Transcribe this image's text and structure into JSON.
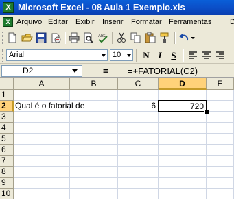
{
  "window": {
    "title": "Microsoft Excel - 08 Aula 1 Exemplo.xls"
  },
  "menu": {
    "items": [
      {
        "label": "Arquivo"
      },
      {
        "label": "Editar"
      },
      {
        "label": "Exibir"
      },
      {
        "label": "Inserir"
      },
      {
        "label": "Formatar"
      },
      {
        "label": "Ferramentas"
      },
      {
        "label": "D"
      }
    ]
  },
  "toolbar": {
    "icons": [
      "new-icon",
      "open-icon",
      "save-icon",
      "permission-icon",
      "print-icon",
      "print-preview-icon",
      "spelling-icon",
      "cut-icon",
      "copy-icon",
      "paste-icon",
      "format-painter-icon",
      "undo-icon"
    ]
  },
  "format_toolbar": {
    "font_name": "Arial",
    "font_size": "10",
    "bold_label": "N",
    "italic_label": "I",
    "underline_label": "S"
  },
  "formula_bar": {
    "name_box": "D2",
    "equals": "=",
    "formula": "=+FATORIAL(C2)"
  },
  "sheet": {
    "columns": [
      "A",
      "B",
      "C",
      "D",
      "E"
    ],
    "rows": [
      "1",
      "2",
      "3",
      "4",
      "5",
      "6",
      "7",
      "8",
      "9",
      "10"
    ],
    "active_column": "D",
    "active_row": "2",
    "cells": {
      "A2": "Qual é o fatorial de",
      "C2": "6",
      "D2": "720"
    }
  },
  "colors": {
    "title_bar": "#0a4fc8",
    "chrome": "#ece9d8",
    "active_header": "#ffd27a",
    "excel_green": "#1e7a2e"
  }
}
